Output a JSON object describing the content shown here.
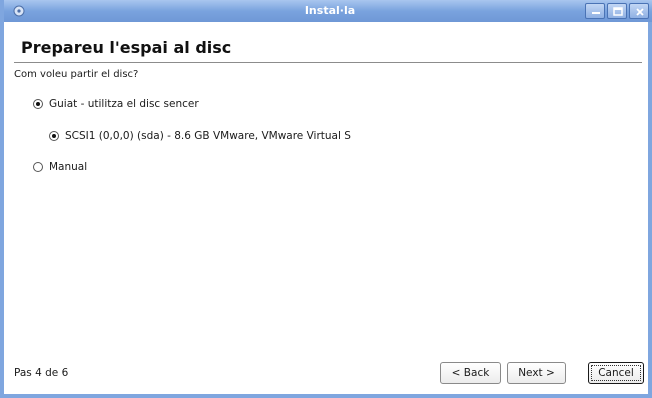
{
  "window": {
    "title": "Instal·la"
  },
  "page": {
    "heading": "Prepareu l'espai al disc",
    "question": "Com voleu partir el disc?"
  },
  "options": {
    "guided": {
      "label": "Guiat - utilitza el disc sencer",
      "checked": true
    },
    "disk": {
      "label": "SCSI1 (0,0,0) (sda) - 8.6 GB VMware, VMware Virtual S",
      "checked": true
    },
    "manual": {
      "label": "Manual",
      "checked": false
    }
  },
  "footer": {
    "status": "Pas 4 de 6",
    "back_label": "< Back",
    "next_label": "Next >",
    "cancel_label": "Cancel"
  },
  "colors": {
    "titlebar": "#7aa3de",
    "frame": "#7fa6df"
  },
  "icons": {
    "app": "installer-disc-icon",
    "minimize": "minimize-icon",
    "maximize": "maximize-icon",
    "close": "close-icon"
  }
}
